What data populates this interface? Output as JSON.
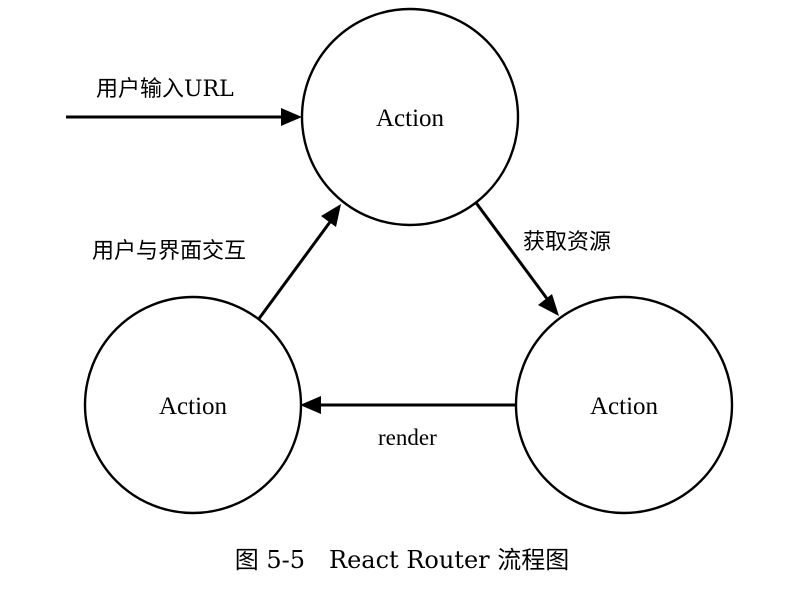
{
  "diagram": {
    "nodes": {
      "top": {
        "label": "Action"
      },
      "left": {
        "label": "Action"
      },
      "right": {
        "label": "Action"
      }
    },
    "edges": {
      "input": {
        "label": "用户输入URL"
      },
      "top_to_right": {
        "label": "获取资源"
      },
      "right_to_left": {
        "label": "render"
      },
      "left_to_top": {
        "label": "用户与界面交互"
      }
    },
    "caption": "图 5-5　React Router 流程图"
  },
  "colors": {
    "stroke": "#000000",
    "background": "#ffffff"
  }
}
